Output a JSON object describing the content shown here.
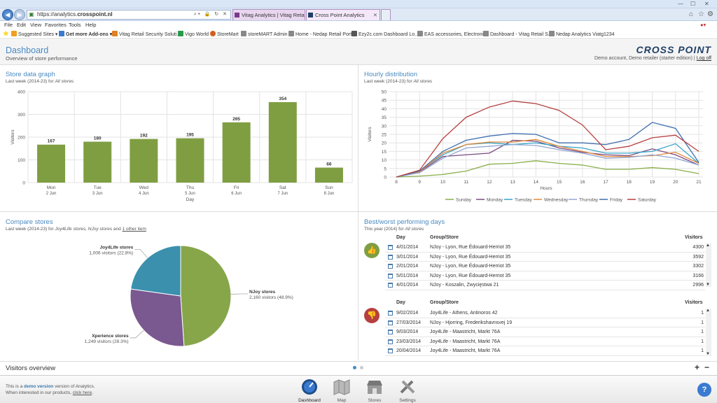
{
  "browser": {
    "url": "https://analytics.crosspoint.nl/",
    "url_plain": "https://analytics.",
    "url_bold": "crosspoint.nl",
    "tabs": [
      {
        "label": "Vitag Analytics | Vitag Retail Se...",
        "active": false
      },
      {
        "label": "Cross Point Analytics",
        "active": true
      }
    ],
    "menu": [
      "File",
      "Edit",
      "View",
      "Favorites",
      "Tools",
      "Help"
    ],
    "favorites": [
      {
        "label": "Suggested Sites ▾",
        "color": "#f0a020"
      },
      {
        "label": "Get more Add-ons ▾",
        "color": "#3a7ad0"
      },
      {
        "label": "Vitag Retail Security Soluti...",
        "color": "#e08020"
      },
      {
        "label": "Vigo World",
        "color": "#2a9a4a"
      },
      {
        "label": "StoreMart",
        "color": "#d06020"
      },
      {
        "label": "storeMART Admin",
        "color": "#888888"
      },
      {
        "label": "Home - Nedap Retail Portal",
        "color": "#888888"
      },
      {
        "label": "Ezy2c.com Dashboard Lo...",
        "color": "#555555"
      },
      {
        "label": "EAS accessories, Electroni...",
        "color": "#888888"
      },
      {
        "label": "Dashboard - Vitag Retail S...",
        "color": "#888888"
      },
      {
        "label": "Nedap Analytics Viatg1234",
        "color": "#888888"
      }
    ]
  },
  "header": {
    "title": "Dashboard",
    "subtitle": "Overview of store performance",
    "logo": "CROSS POINT",
    "account": "Demo account, Demo retailer (starter edition) |",
    "logoff": "Log off"
  },
  "store_graph": {
    "title": "Store data graph",
    "sub_prefix": "Last week (2014-23) for ",
    "sub_scope": "All stores"
  },
  "hourly": {
    "title": "Hourly distribution",
    "sub_prefix": "Last week (2014-23) for ",
    "sub_scope": "All stores"
  },
  "compare": {
    "title": "Compare stores",
    "sub_prefix": "Last week (2014-23) for ",
    "sub_scope": "Joy4Life stores, NJoy stores",
    "sub_and": " and ",
    "sub_link": "1 other item"
  },
  "bestworst": {
    "title": "Best/worst performing days",
    "sub_prefix": "This year (2014) for ",
    "sub_scope": "All stores",
    "col_day": "Day",
    "col_group": "Group/Store",
    "col_visitors": "Visitors",
    "best": [
      {
        "day": "4/01/2014",
        "group": "NJoy - Lyon, Rue Édouard-Herriot 35",
        "visitors": "4300"
      },
      {
        "day": "3/01/2014",
        "group": "NJoy - Lyon, Rue Édouard-Herriot 35",
        "visitors": "3592"
      },
      {
        "day": "2/01/2014",
        "group": "NJoy - Lyon, Rue Édouard-Herriot 35",
        "visitors": "3302"
      },
      {
        "day": "5/01/2014",
        "group": "NJoy - Lyon, Rue Édouard-Herriot 35",
        "visitors": "3166"
      },
      {
        "day": "4/01/2014",
        "group": "NJoy - Koszalin, Zwycięstwa 21",
        "visitors": "2996"
      }
    ],
    "worst": [
      {
        "day": "9/02/2014",
        "group": "Joy4Life - Athens, Antinoros 42",
        "visitors": "1"
      },
      {
        "day": "27/03/2014",
        "group": "NJoy - Hjorring, Frederikshavnsvej 19",
        "visitors": "1"
      },
      {
        "day": "9/03/2014",
        "group": "Joy4Life - Maastricht, Markt 76A",
        "visitors": "1"
      },
      {
        "day": "23/03/2014",
        "group": "Joy4Life - Maastricht, Markt 76A",
        "visitors": "1"
      },
      {
        "day": "20/04/2014",
        "group": "Joy4Life - Maastricht, Markt 76A",
        "visitors": "1"
      }
    ]
  },
  "visitors_overview": {
    "title": "Visitors overview",
    "plus": "+",
    "minus": "−"
  },
  "footer": {
    "t1": "This is a ",
    "demo": "demo version",
    "t2": " version of Analytics.",
    "t3": "When interested in our products, ",
    "click": "click here",
    "t4": ".",
    "nav": [
      {
        "label": "Dashboard",
        "icon": "dashboard-icon",
        "active": true
      },
      {
        "label": "Map",
        "icon": "map-icon",
        "active": false
      },
      {
        "label": "Stores",
        "icon": "stores-icon",
        "active": false
      },
      {
        "label": "Settings",
        "icon": "settings-icon",
        "active": false
      }
    ],
    "help": "?"
  },
  "chart_data": [
    {
      "type": "bar",
      "categories": [
        "Mon\n2 Jun",
        "Tue\n3 Jun",
        "Wed\n4 Jun",
        "Thu\n5 Jun",
        "Fri\n6 Jun",
        "Sat\n7 Jun",
        "Sun\n8 Jun"
      ],
      "cat_day": [
        "Mon",
        "Tue",
        "Wed",
        "Thu",
        "Fri",
        "Sat",
        "Sun"
      ],
      "cat_date": [
        "2 Jun",
        "3 Jun",
        "4 Jun",
        "5 Jun",
        "6 Jun",
        "7 Jun",
        "8 Jun"
      ],
      "values": [
        167,
        180,
        192,
        195,
        265,
        354,
        66
      ],
      "xlabel": "Day",
      "ylabel": "Visitors",
      "ylim": [
        0,
        400
      ],
      "yticks": [
        0,
        100,
        200,
        300,
        400
      ],
      "color": "#7f9e42",
      "grid": true
    },
    {
      "type": "line",
      "x": [
        8,
        9,
        10,
        11,
        12,
        13,
        14,
        15,
        16,
        17,
        18,
        19,
        20,
        21
      ],
      "xlabel": "Hours",
      "ylabel": "Visitors",
      "ylim": [
        0,
        50
      ],
      "yticks": [
        0,
        5,
        10,
        15,
        20,
        25,
        30,
        35,
        40,
        45,
        50
      ],
      "legend_position": "bottom",
      "series": [
        {
          "name": "Sunday",
          "color": "#8aae4a",
          "values": [
            0,
            0.5,
            1.5,
            3.5,
            7.5,
            8,
            9.5,
            8,
            7,
            4.5,
            4.5,
            5.5,
            4.5,
            2
          ]
        },
        {
          "name": "Monday",
          "color": "#7a4a80",
          "values": [
            0,
            3,
            12,
            13,
            14,
            21.5,
            21,
            17,
            14.5,
            13,
            12.5,
            16.5,
            13,
            7
          ]
        },
        {
          "name": "Tuesday",
          "color": "#38a3c8",
          "values": [
            0,
            3.5,
            13,
            19,
            20,
            19,
            20,
            18,
            17,
            14,
            14,
            15,
            19.5,
            8
          ]
        },
        {
          "name": "Wednesday",
          "color": "#e28a3a",
          "values": [
            0,
            3,
            14,
            19,
            20.5,
            20.5,
            22,
            18,
            15,
            12,
            12,
            12.5,
            14.5,
            8
          ]
        },
        {
          "name": "Thursday",
          "color": "#8fa6d4",
          "values": [
            0,
            2.5,
            11,
            17,
            18,
            19,
            18.5,
            16,
            14,
            11,
            11.5,
            13,
            11,
            7
          ]
        },
        {
          "name": "Friday",
          "color": "#3f6fae",
          "values": [
            0,
            3.5,
            15,
            21.5,
            24,
            25.5,
            25,
            20,
            20,
            19,
            22,
            32,
            28.5,
            8.5
          ]
        },
        {
          "name": "Saturday",
          "color": "#b64040",
          "values": [
            0,
            4,
            22.5,
            35,
            41,
            44.5,
            43,
            39,
            30.5,
            16,
            18,
            23,
            24.5,
            15
          ]
        }
      ]
    },
    {
      "type": "pie",
      "slices": [
        {
          "name": "NJoy stores",
          "value": 2160,
          "label": "2,160 visitors (48.9%)",
          "color": "#87a64a"
        },
        {
          "name": "Xperience stores",
          "value": 1249,
          "label": "1,249 visitors (28.3%)",
          "color": "#7a5890"
        },
        {
          "name": "Joy4Life stores",
          "value": 1006,
          "label": "1,006 visitors (22.8%)",
          "color": "#3a90ad"
        }
      ]
    }
  ]
}
